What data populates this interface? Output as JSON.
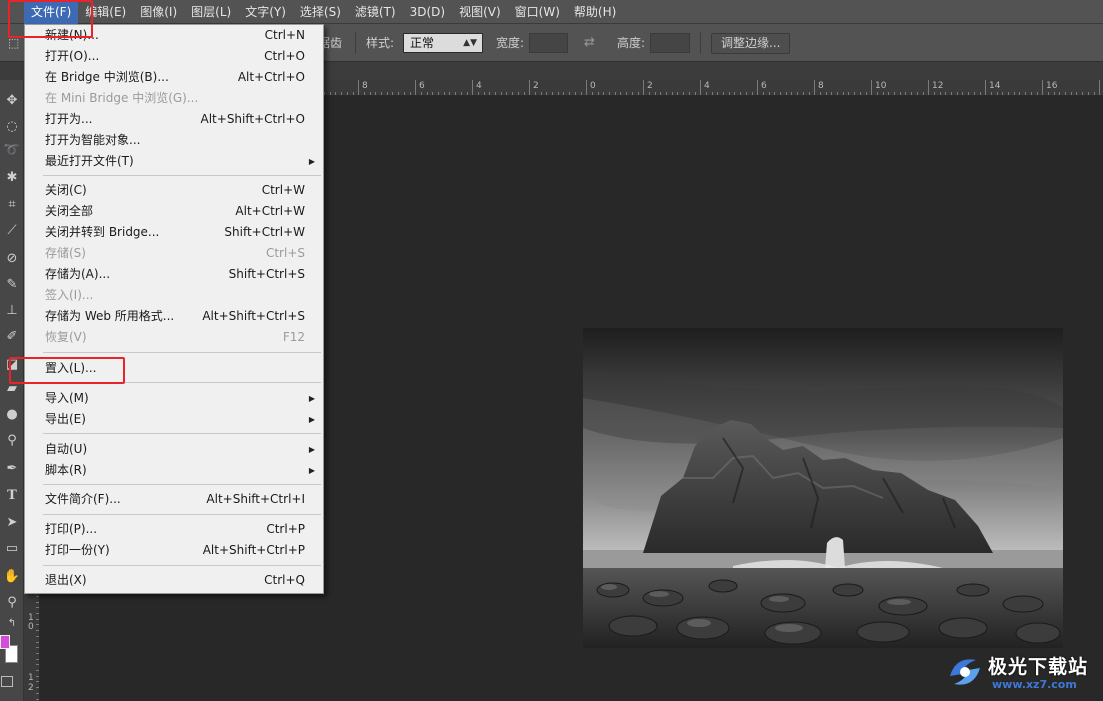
{
  "menubar": {
    "items": [
      "文件(F)",
      "编辑(E)",
      "图像(I)",
      "图层(L)",
      "文字(Y)",
      "选择(S)",
      "滤镜(T)",
      "3D(D)",
      "视图(V)",
      "窗口(W)",
      "帮助(H)"
    ]
  },
  "options_bar": {
    "partial_label": "消除锯齿",
    "style_label": "样式:",
    "style_value": "正常",
    "width_label": "宽度:",
    "height_label": "高度:",
    "refine_edge_button": "调整边缘..."
  },
  "file_menu": {
    "items": [
      {
        "label": "新建(N)...",
        "shortcut": "Ctrl+N"
      },
      {
        "label": "打开(O)...",
        "shortcut": "Ctrl+O"
      },
      {
        "label": "在 Bridge 中浏览(B)...",
        "shortcut": "Alt+Ctrl+O"
      },
      {
        "label": "在 Mini Bridge 中浏览(G)...",
        "shortcut": "",
        "disabled": true
      },
      {
        "label": "打开为...",
        "shortcut": "Alt+Shift+Ctrl+O"
      },
      {
        "label": "打开为智能对象...",
        "shortcut": ""
      },
      {
        "label": "最近打开文件(T)",
        "shortcut": "",
        "submenu": true
      },
      {
        "label": "关闭(C)",
        "shortcut": "Ctrl+W"
      },
      {
        "label": "关闭全部",
        "shortcut": "Alt+Ctrl+W"
      },
      {
        "label": "关闭并转到 Bridge...",
        "shortcut": "Shift+Ctrl+W"
      },
      {
        "label": "存储(S)",
        "shortcut": "Ctrl+S",
        "disabled": true
      },
      {
        "label": "存储为(A)...",
        "shortcut": "Shift+Ctrl+S"
      },
      {
        "label": "签入(I)...",
        "shortcut": "",
        "disabled": true
      },
      {
        "label": "存储为 Web 所用格式...",
        "shortcut": "Alt+Shift+Ctrl+S"
      },
      {
        "label": "恢复(V)",
        "shortcut": "F12",
        "disabled": true
      },
      {
        "label": "置入(L)...",
        "shortcut": ""
      },
      {
        "label": "导入(M)",
        "shortcut": "",
        "submenu": true
      },
      {
        "label": "导出(E)",
        "shortcut": "",
        "submenu": true
      },
      {
        "label": "自动(U)",
        "shortcut": "",
        "submenu": true
      },
      {
        "label": "脚本(R)",
        "shortcut": "",
        "submenu": true
      },
      {
        "label": "文件简介(F)...",
        "shortcut": "Alt+Shift+Ctrl+I"
      },
      {
        "label": "打印(P)...",
        "shortcut": "Ctrl+P"
      },
      {
        "label": "打印一份(Y)",
        "shortcut": "Alt+Shift+Ctrl+P"
      },
      {
        "label": "退出(X)",
        "shortcut": "Ctrl+Q"
      }
    ],
    "highlighted_item": "置入(L)..."
  },
  "ruler": {
    "top_labels": [
      "8",
      "6",
      "4",
      "2",
      "0",
      "2",
      "4",
      "6",
      "8",
      "10",
      "12",
      "14",
      "16"
    ],
    "left_labels": [
      "1",
      "0",
      "1",
      "2"
    ]
  },
  "watermark": {
    "title": "极光下载站",
    "url": "www.xz7.com"
  },
  "colors": {
    "foreground_swatch": "#d24dd8",
    "background_swatch": "#ffffff",
    "highlight_box": "#e8232a",
    "menu_active": "#3d6ab3"
  },
  "tools": [
    "move-tool",
    "marquee-tool",
    "lasso-tool",
    "magic-wand-tool",
    "crop-tool",
    "eyedropper-tool",
    "healing-brush-tool",
    "brush-tool",
    "clone-stamp-tool",
    "history-brush-tool",
    "eraser-tool",
    "gradient-tool",
    "blur-tool",
    "dodge-tool",
    "pen-tool",
    "type-tool",
    "path-selection-tool",
    "shape-tool",
    "hand-tool",
    "zoom-tool"
  ]
}
